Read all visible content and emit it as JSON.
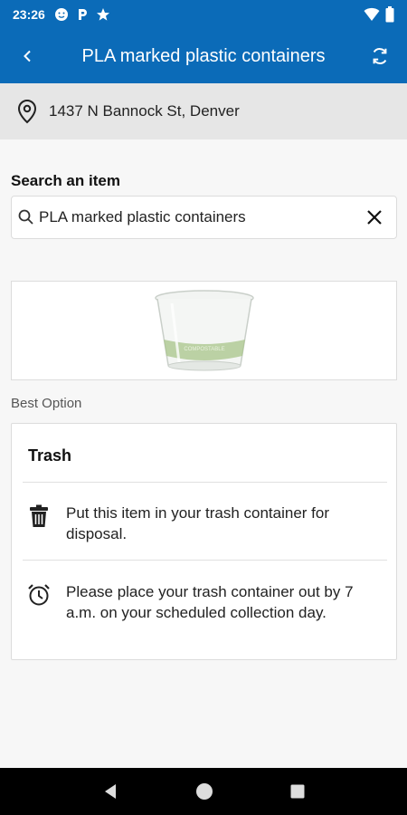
{
  "status_bar": {
    "time": "23:26",
    "icons": [
      "face-icon",
      "p-icon",
      "star-icon"
    ],
    "right_icons": [
      "wifi-icon",
      "battery-icon"
    ]
  },
  "app_bar": {
    "title": "PLA marked plastic containers",
    "back_icon": "back-icon",
    "refresh_icon": "refresh-icon"
  },
  "location": {
    "address": "1437 N Bannock St, Denver",
    "icon": "location-pin-icon"
  },
  "search": {
    "label": "Search an item",
    "value": "PLA marked plastic containers",
    "icons": [
      "search-icon",
      "close-icon"
    ]
  },
  "item_image": {
    "description_icon": "cup-image",
    "printed_text": "COMPOSTABLE"
  },
  "best_option": {
    "label": "Best Option",
    "title": "Trash",
    "rows": [
      {
        "icon": "trash-can-icon",
        "text": "Put this item in your trash container for disposal."
      },
      {
        "icon": "alarm-clock-icon",
        "text": "Please place your trash container out by 7 a.m. on your scheduled collection day."
      }
    ]
  },
  "colors": {
    "accent": "#0b6bb8",
    "location_bg": "#e6e6e6"
  },
  "nav_bar": {
    "icons": [
      "nav-back-icon",
      "home-icon",
      "recents-icon"
    ]
  }
}
